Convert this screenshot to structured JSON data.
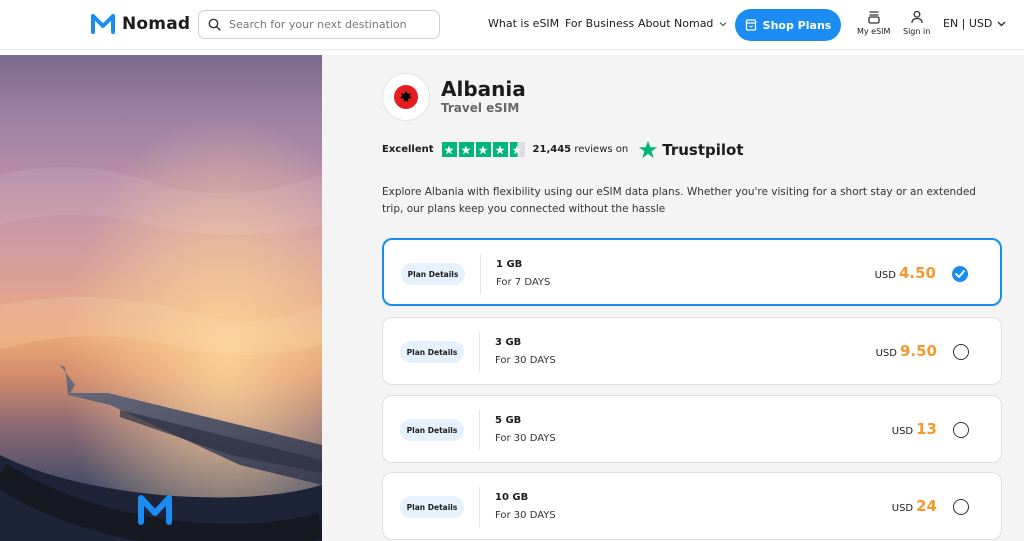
{
  "header": {
    "brand": "Nomad",
    "search_placeholder": "Search for your next destination",
    "nav": [
      "What is eSIM",
      "For Business",
      "About Nomad"
    ],
    "shop_label": "Shop Plans",
    "my_esim_label": "My eSIM",
    "signin_label": "Sign in",
    "language": "EN | USD"
  },
  "product": {
    "country": "Albania",
    "subtitle": "Travel eSIM",
    "flag_colors": {
      "background": "#e41e20",
      "emblem": "#000000"
    }
  },
  "trustpilot": {
    "rating_text": "Excellent",
    "review_count": "21,445",
    "reviews_suffix": "reviews on",
    "brand": "Trustpilot",
    "stars": 4.5,
    "star_color": "#00b67a"
  },
  "description": "Explore Albania with flexibility using our eSIM data plans. Whether you're visiting for a short stay or an extended trip, our plans keep you connected without the hassle",
  "plans": [
    {
      "details_label": "Plan Details",
      "data": "1 GB",
      "duration": "For 7 DAYS",
      "currency": "USD",
      "price": "4.50",
      "selected": true
    },
    {
      "details_label": "Plan Details",
      "data": "3 GB",
      "duration": "For 30 DAYS",
      "currency": "USD",
      "price": "9.50",
      "selected": false
    },
    {
      "details_label": "Plan Details",
      "data": "5 GB",
      "duration": "For 30 DAYS",
      "currency": "USD",
      "price": "13",
      "selected": false
    },
    {
      "details_label": "Plan Details",
      "data": "10 GB",
      "duration": "For 30 DAYS",
      "currency": "USD",
      "price": "24",
      "selected": false
    }
  ],
  "colors": {
    "accent": "#1b8df2",
    "price": "#f39a2e",
    "plan_pill": "#e5f1fc"
  }
}
